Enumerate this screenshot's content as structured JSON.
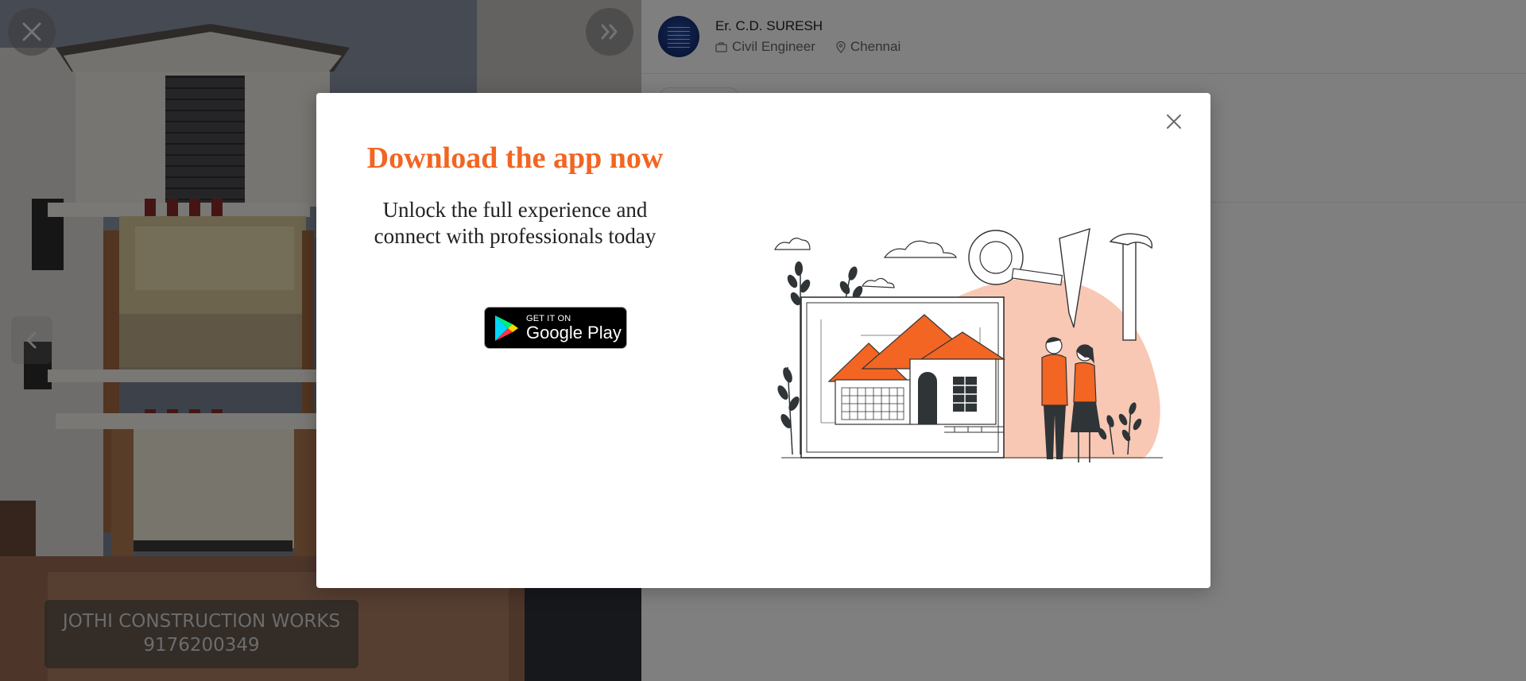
{
  "viewer": {
    "watermark_line1": "JOTHI CONSTRUCTION WORKS",
    "watermark_line2": "9176200349"
  },
  "profile": {
    "name": "Er. C.D. SURESH",
    "role": "Civil Engineer",
    "location": "Chennai"
  },
  "modal": {
    "title": "Download the app now",
    "subtitle_line1": "Unlock the full experience and",
    "subtitle_line2": "connect with professionals today",
    "store_badge": {
      "small": "GET IT ON",
      "big": "Google Play"
    }
  },
  "colors": {
    "accent": "#f26522",
    "overlay": "rgba(0,0,0,0.5)",
    "illustration_blob": "#f8c8b4"
  },
  "icons": [
    "close-icon",
    "double-chevron-right-icon",
    "chevron-left-icon",
    "briefcase-icon",
    "location-pin-icon",
    "google-play-icon"
  ]
}
